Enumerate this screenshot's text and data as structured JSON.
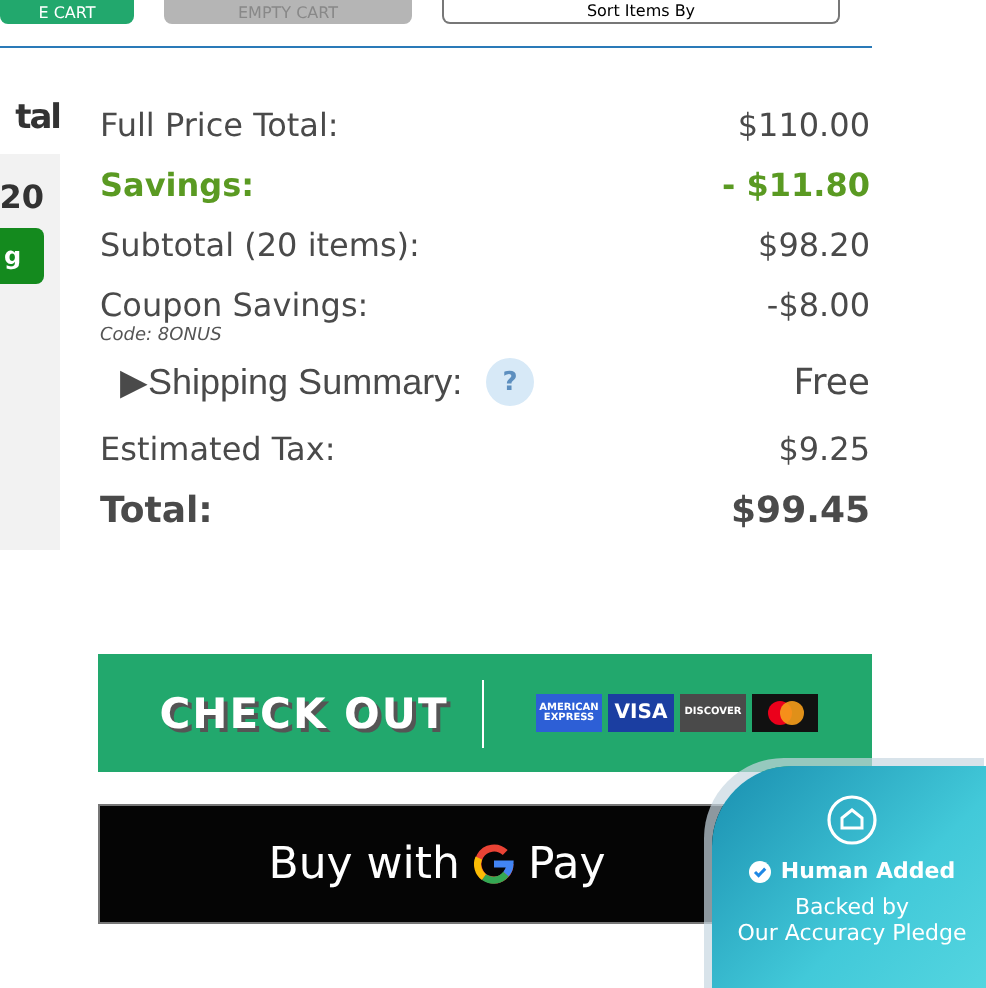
{
  "top_buttons": [
    {
      "label": "E CART",
      "kind": "primary"
    },
    {
      "label": "EMPTY CART",
      "kind": "disabled"
    },
    {
      "label": "Sort Items By",
      "kind": "select"
    }
  ],
  "left_column": {
    "heading": "tal",
    "count": "20",
    "badge": "g"
  },
  "summary": [
    {
      "label": "Full Price Total:",
      "value": "$110.00",
      "kind": "normal"
    },
    {
      "label": "Savings:",
      "value": "- $11.80",
      "kind": "savings"
    },
    {
      "label": "Subtotal (20 items):",
      "value": "$98.20",
      "kind": "normal"
    },
    {
      "label": "Coupon Savings:",
      "value": "-$8.00",
      "kind": "normal",
      "note": "Code: 8ONUS"
    },
    {
      "label": "▶Shipping Summary:",
      "value": "Free",
      "kind": "shipping",
      "help": "?"
    },
    {
      "label": "Estimated Tax:",
      "value": "$9.25",
      "kind": "normal"
    },
    {
      "label": "Total:",
      "value": "$99.45",
      "kind": "total"
    }
  ],
  "checkout": {
    "label": "CHECK OUT",
    "cards": [
      {
        "kind": "text",
        "label": "AMERICAN EXPRESS"
      },
      {
        "kind": "text",
        "label": "VISA"
      },
      {
        "kind": "text",
        "label": "DISCOVER"
      },
      {
        "kind": "circles"
      }
    ]
  },
  "gpay": {
    "before": "Buy with",
    "after": "Pay"
  },
  "badge": {
    "title": "Human Added",
    "line1": "Backed by",
    "line2": "Our Accuracy Pledge"
  }
}
